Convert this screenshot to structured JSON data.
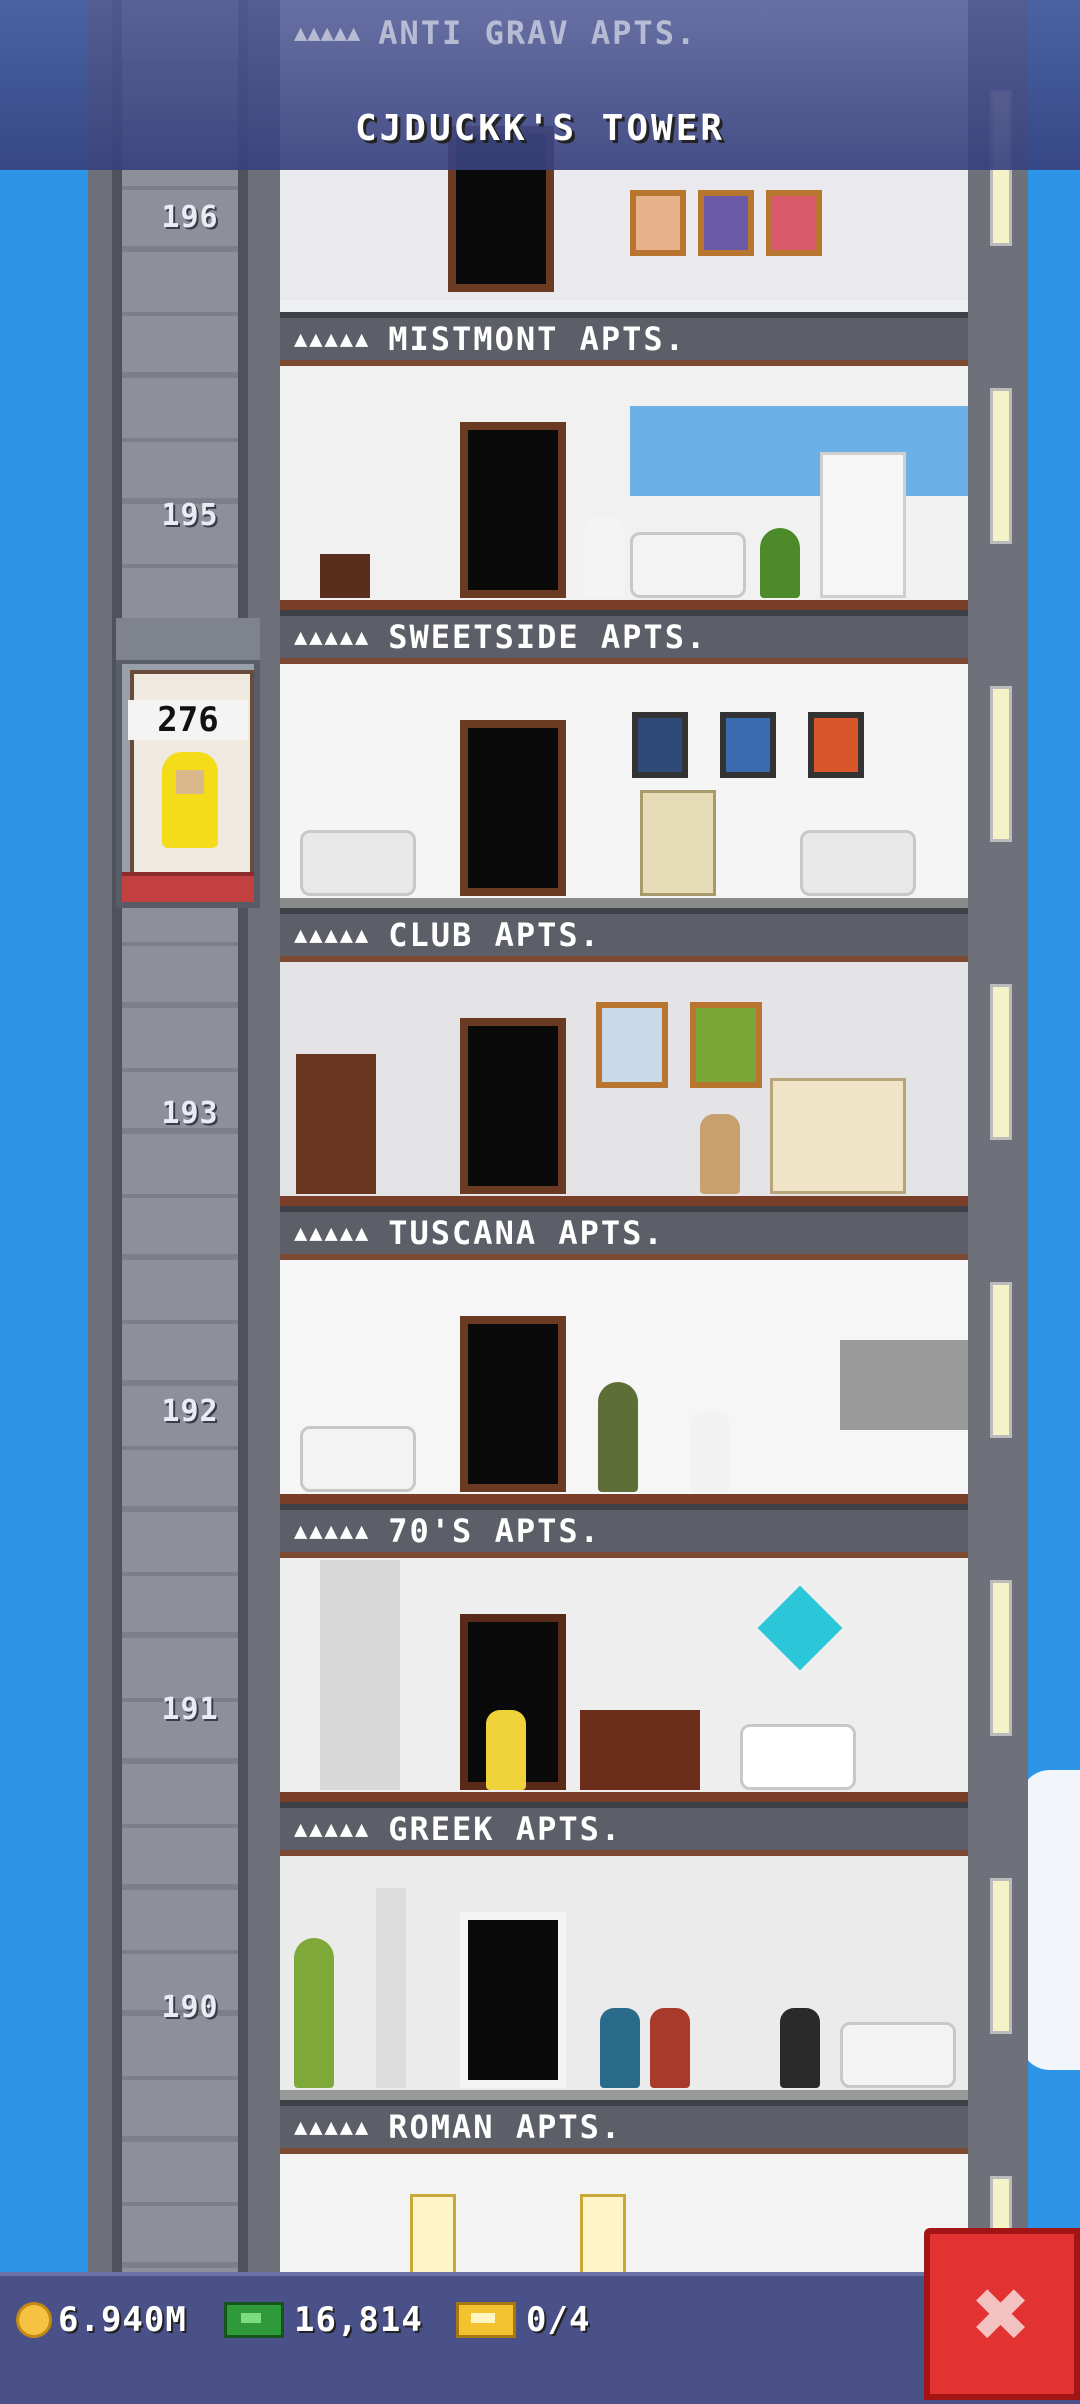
{
  "header": {
    "top_floor_name": "ANTI GRAV APTS.",
    "tower_title": "CJDUCKK'S TOWER"
  },
  "elevator": {
    "count": "276"
  },
  "floors": [
    {
      "number": "196",
      "sign": "MISTMONT APTS."
    },
    {
      "number": "195",
      "sign": "SWEETSIDE APTS."
    },
    {
      "number": "",
      "sign": "CLUB APTS."
    },
    {
      "number": "193",
      "sign": "TUSCANA APTS."
    },
    {
      "number": "192",
      "sign": "70'S APTS."
    },
    {
      "number": "191",
      "sign": "GREEK APTS."
    },
    {
      "number": "190",
      "sign": "ROMAN APTS."
    }
  ],
  "sign_stars": "▲▲▲▲▲",
  "footer": {
    "coins": "6.940M",
    "bux": "16,814",
    "tickets": "0/4",
    "close_glyph": "✖"
  },
  "colors": {
    "sky": "#2c95e8",
    "close_button": "#e23232",
    "footer": "#4a5088"
  },
  "icons": [
    "coin-icon",
    "bux-icon",
    "ticket-icon",
    "close-icon"
  ]
}
